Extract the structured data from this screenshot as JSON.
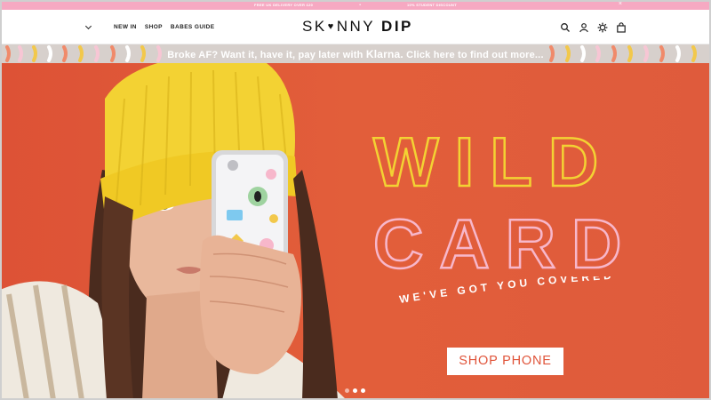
{
  "announcement": {
    "left": "FREE UK DELIVERY OVER £20",
    "separator": "•",
    "right": "10% STUDENT DISCOUNT",
    "close": "×"
  },
  "header": {
    "menu_icon": "chevron-down-icon",
    "nav": [
      "NEW IN",
      "SHOP",
      "BABES GUIDE"
    ],
    "logo": {
      "part1": "SK",
      "heart": "♥",
      "part2": "NNY",
      "part3": "DIP"
    },
    "icons": [
      "search-icon",
      "account-icon",
      "settings-icon",
      "bag-icon"
    ]
  },
  "klarna_banner": {
    "text_before": "Broke AF? Want it, have it, pay later with ",
    "brand": "Klarna.",
    "text_after": " Click here to find out more..."
  },
  "hero": {
    "headline_line1": "WILD",
    "headline_line2": "CARD",
    "tagline": "WE'VE GOT YOU COVERED",
    "cta": "SHOP PHONE",
    "slides": 3,
    "active_slide": 1,
    "colors": {
      "background": "#e05a3a",
      "beanie": "#f3d233",
      "cta_text": "#e0543a"
    }
  }
}
